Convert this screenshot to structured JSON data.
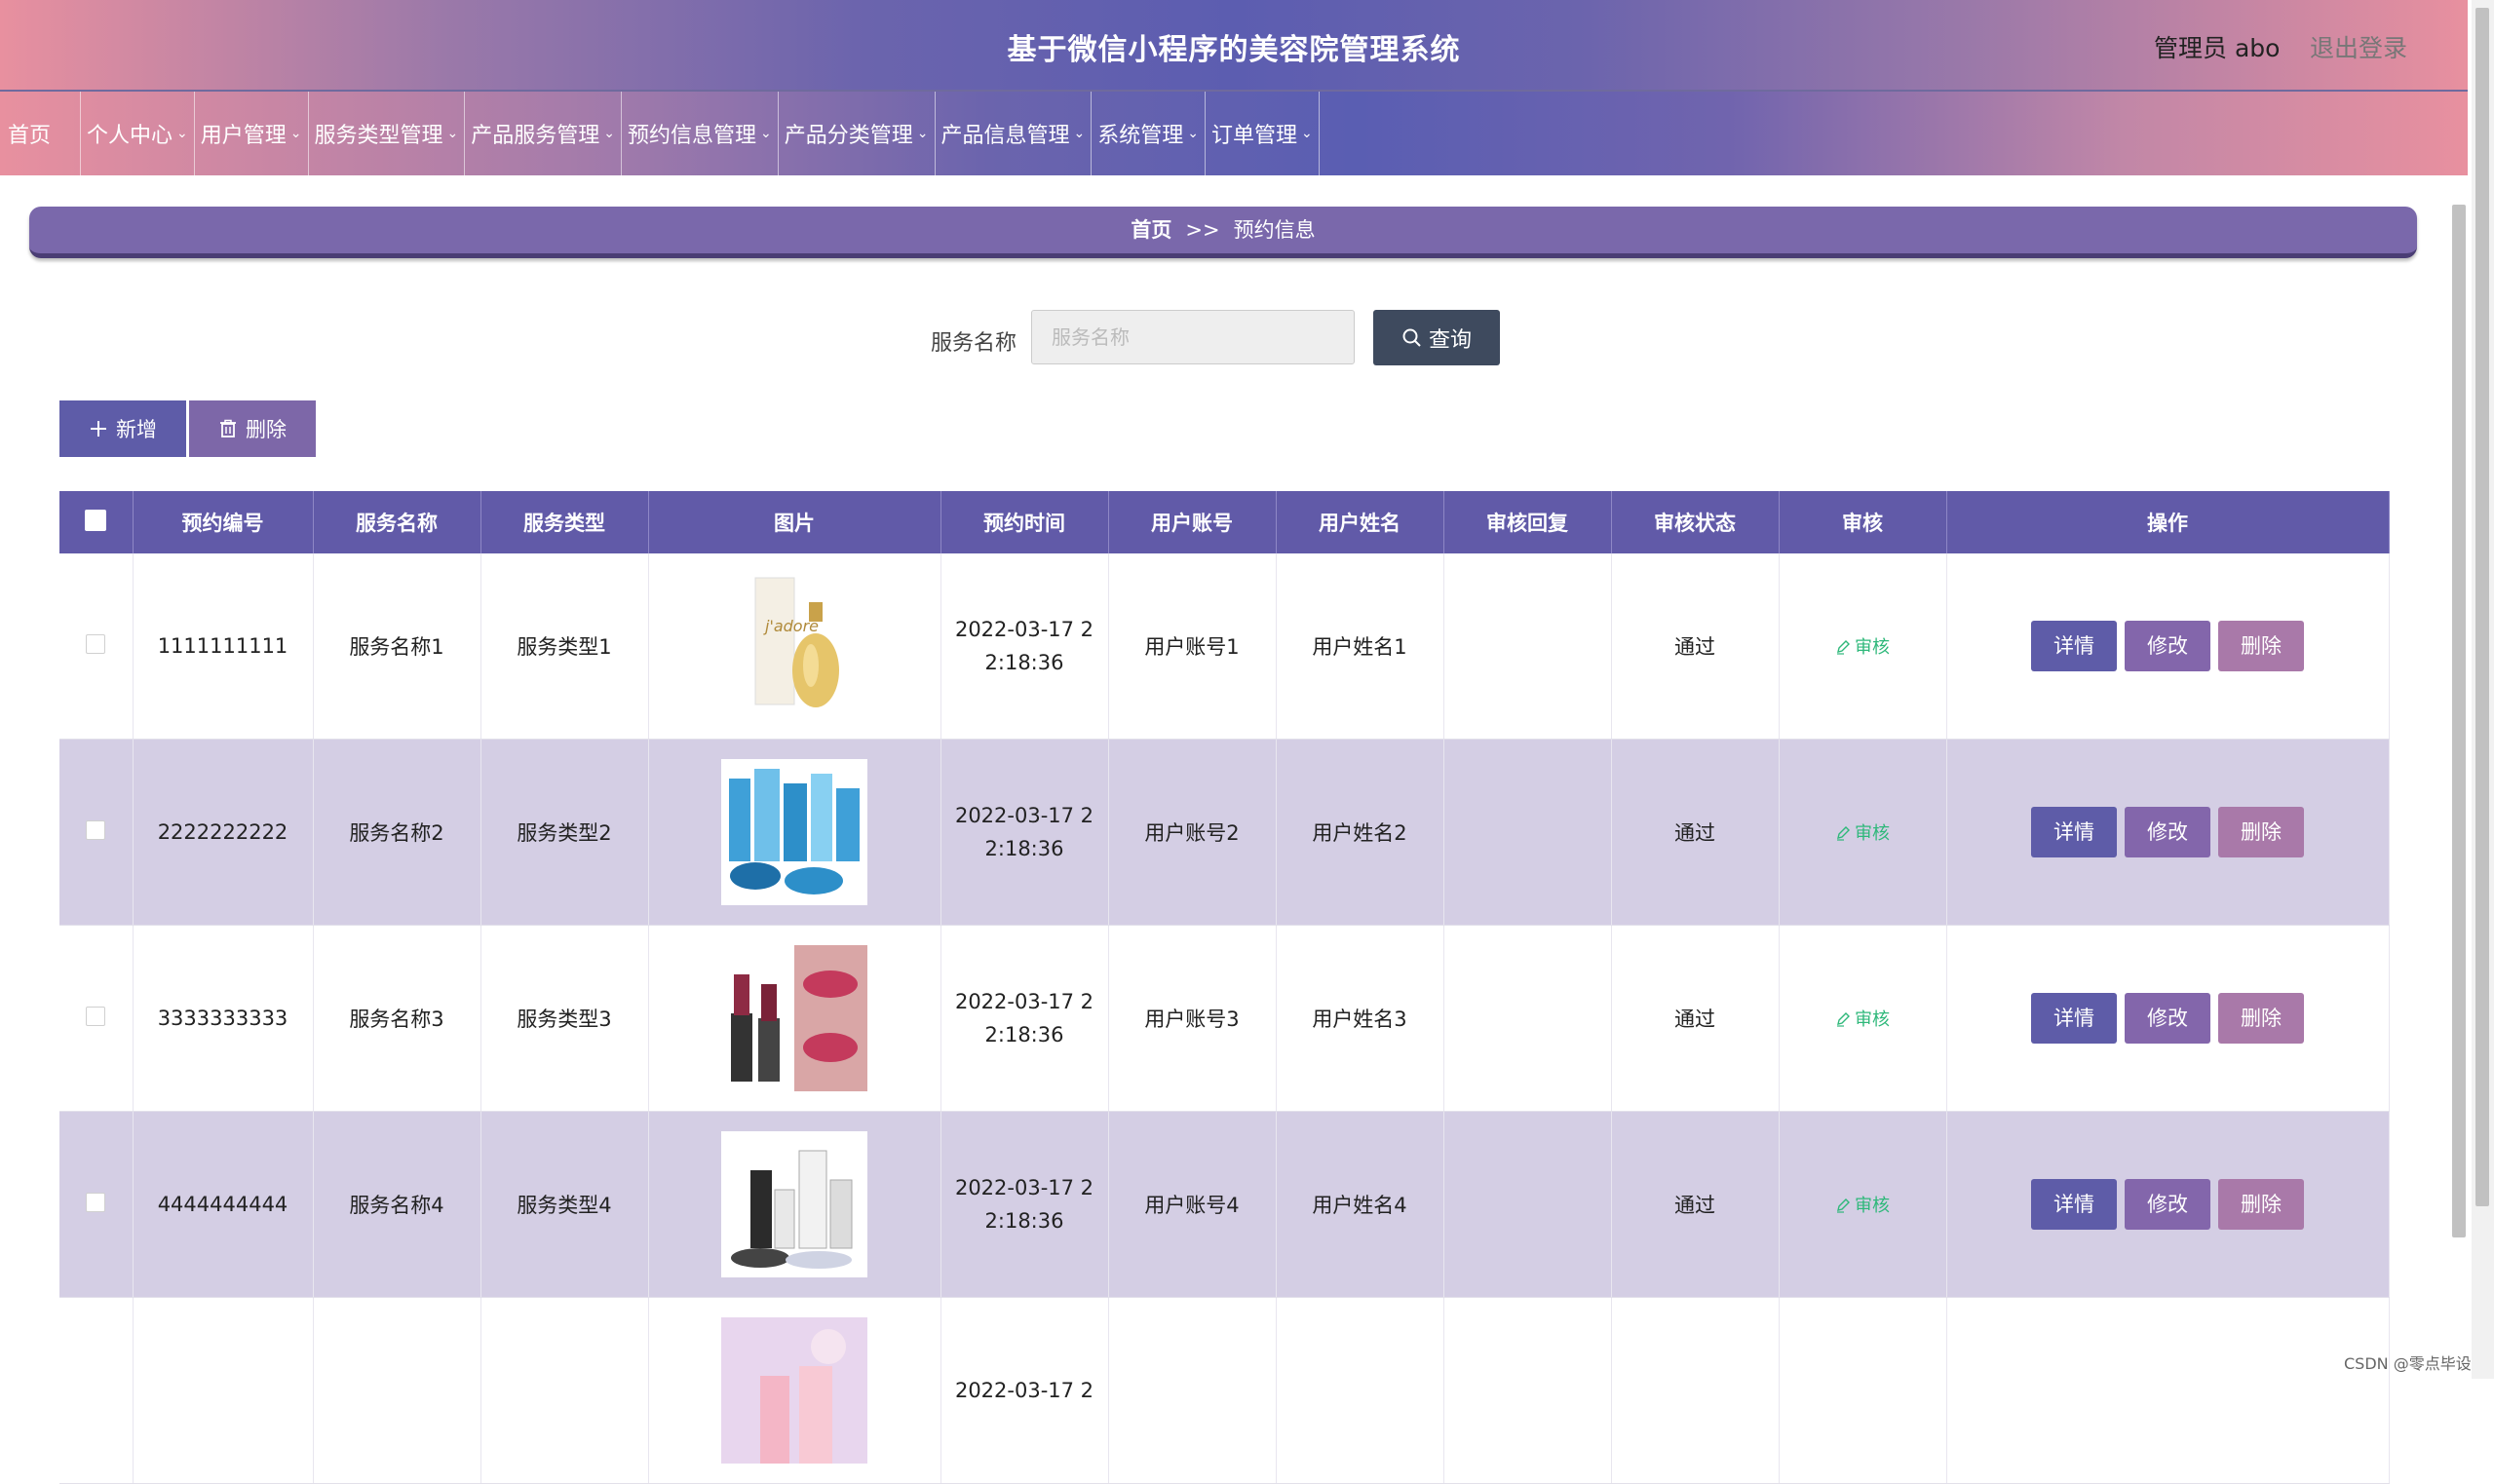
{
  "header": {
    "title": "基于微信小程序的美容院管理系统",
    "admin": "管理员 abo",
    "logout": "退出登录"
  },
  "nav": {
    "items": [
      {
        "label": "首页",
        "dropdown": false
      },
      {
        "label": "个人中心",
        "dropdown": true
      },
      {
        "label": "用户管理",
        "dropdown": true
      },
      {
        "label": "服务类型管理",
        "dropdown": true
      },
      {
        "label": "产品服务管理",
        "dropdown": true
      },
      {
        "label": "预约信息管理",
        "dropdown": true
      },
      {
        "label": "产品分类管理",
        "dropdown": true
      },
      {
        "label": "产品信息管理",
        "dropdown": true
      },
      {
        "label": "系统管理",
        "dropdown": true
      },
      {
        "label": "订单管理",
        "dropdown": true
      }
    ]
  },
  "breadcrumb": {
    "home": "首页",
    "separator": ">>",
    "current": "预约信息"
  },
  "search": {
    "label": "服务名称",
    "placeholder": "服务名称",
    "value": "",
    "button": "查询"
  },
  "actions": {
    "add": "新增",
    "delete": "删除"
  },
  "table": {
    "columns": [
      "预约编号",
      "服务名称",
      "服务类型",
      "图片",
      "预约时间",
      "用户账号",
      "用户姓名",
      "审核回复",
      "审核状态",
      "审核",
      "操作"
    ],
    "rows": [
      {
        "id": "1111111111",
        "service": "服务名称1",
        "type": "服务类型1",
        "image": "perfume-bottle",
        "time": "2022-03-17 22:18:36",
        "account": "用户账号1",
        "name": "用户姓名1",
        "reply": "",
        "status": "通过"
      },
      {
        "id": "2222222222",
        "service": "服务名称2",
        "type": "服务类型2",
        "image": "skincare-set-blue",
        "time": "2022-03-17 22:18:36",
        "account": "用户账号2",
        "name": "用户姓名2",
        "reply": "",
        "status": "通过"
      },
      {
        "id": "3333333333",
        "service": "服务名称3",
        "type": "服务类型3",
        "image": "lipstick",
        "time": "2022-03-17 22:18:36",
        "account": "用户账号3",
        "name": "用户姓名3",
        "reply": "",
        "status": "通过"
      },
      {
        "id": "4444444444",
        "service": "服务名称4",
        "type": "服务类型4",
        "image": "cosmetic-bottles",
        "time": "2022-03-17 22:18:36",
        "account": "用户账号4",
        "name": "用户姓名4",
        "reply": "",
        "status": "通过"
      },
      {
        "id": "",
        "service": "",
        "type": "",
        "image": "pink-cosmetics",
        "time": "2022-03-17 2",
        "account": "",
        "name": "",
        "reply": "",
        "status": ""
      }
    ],
    "audit_label": "审核",
    "ops": {
      "detail": "详情",
      "edit": "修改",
      "delete": "删除"
    }
  },
  "watermark": "CSDN @零点毕设",
  "colors": {
    "header_purple": "#615aa8",
    "row_alt": "#d4cee4",
    "audit_green": "#2eb87a",
    "search_btn": "#3e4a5e"
  }
}
